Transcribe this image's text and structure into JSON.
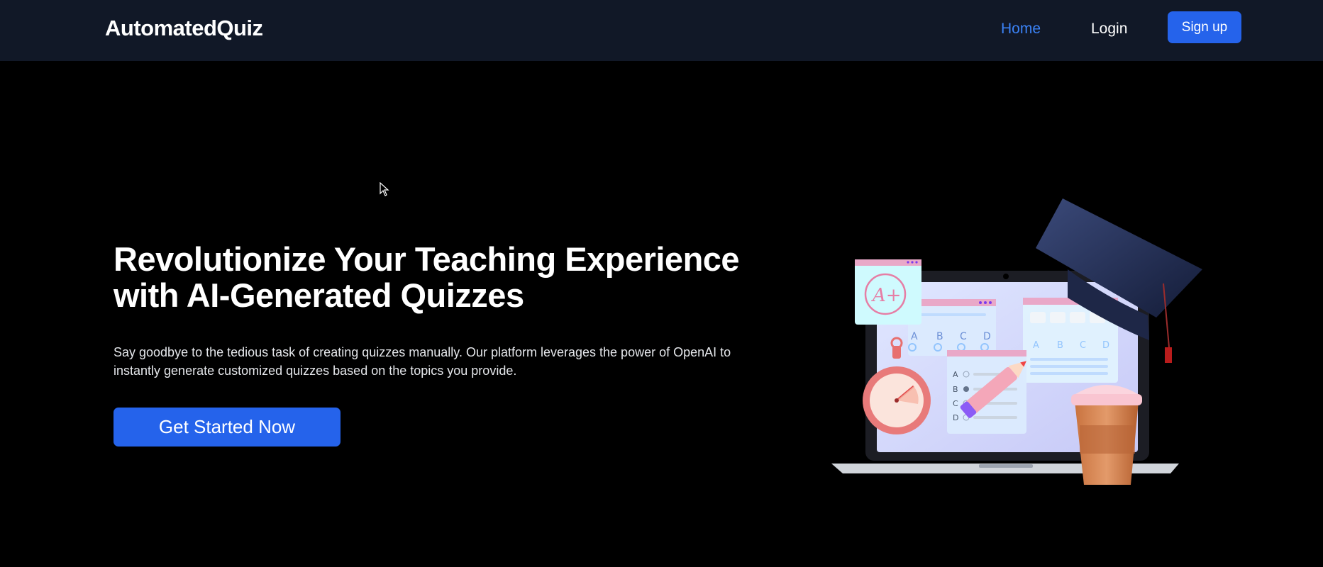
{
  "navbar": {
    "brand": "AutomatedQuiz",
    "links": [
      {
        "label": "Home",
        "active": true
      },
      {
        "label": "Login",
        "active": false
      }
    ],
    "signup_label": "Sign up"
  },
  "hero": {
    "title": "Revolutionize Your Teaching Experience with AI-Generated Quizzes",
    "description": "Say goodbye to the tedious task of creating quizzes manually. Our platform leverages the power of OpenAI to instantly generate customized quizzes based on the topics you provide.",
    "cta_label": "Get Started Now"
  },
  "illustration": {
    "grade": "A+",
    "choices": [
      "A",
      "B",
      "C",
      "D"
    ]
  },
  "colors": {
    "navbar_bg": "#111827",
    "page_bg": "#000000",
    "accent": "#2563eb",
    "active_link": "#3b82f6"
  }
}
